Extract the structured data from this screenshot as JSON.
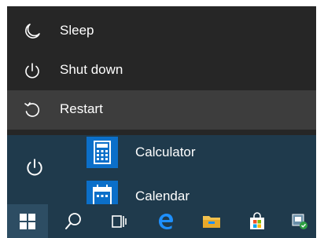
{
  "power_menu": {
    "items": [
      {
        "label": "Sleep",
        "icon": "moon-icon"
      },
      {
        "label": "Shut down",
        "icon": "power-icon"
      },
      {
        "label": "Restart",
        "icon": "restart-icon",
        "selected": true
      }
    ]
  },
  "start_menu": {
    "rail_icon": "power-icon",
    "apps": [
      {
        "label": "Calculator",
        "icon": "calculator-icon"
      },
      {
        "label": "Calendar",
        "icon": "calendar-icon"
      }
    ]
  },
  "taskbar": {
    "buttons": [
      "windows-start-icon",
      "search-icon",
      "task-view-icon",
      "edge-icon",
      "file-explorer-icon",
      "store-icon",
      "app-icon"
    ]
  },
  "colors": {
    "flyout_bg": "#262626",
    "selected_bg": "#3d3d3d",
    "start_bg": "#1f3a4c",
    "tile_blue": "#0b6fc9"
  }
}
